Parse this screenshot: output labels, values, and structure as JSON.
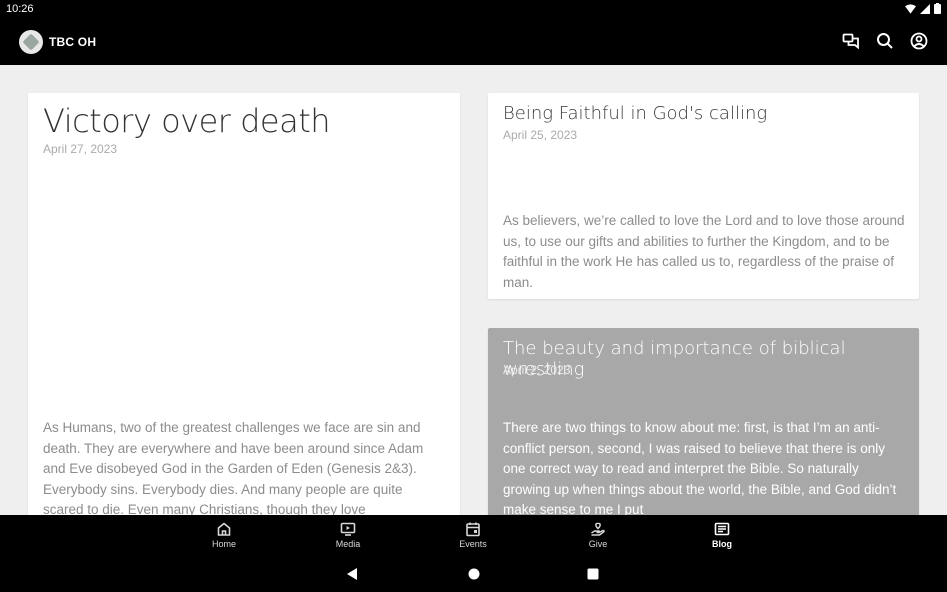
{
  "status": {
    "time": "10:26"
  },
  "app": {
    "title": "TBC OH"
  },
  "actions": [
    "chat-icon",
    "search-icon",
    "account-icon"
  ],
  "posts": [
    {
      "title": "Victory over death",
      "date": "April 27, 2023",
      "excerpt": "As Humans, two of the greatest challenges we face are sin and death. They are everywhere and have been around since Adam and Eve disobeyed God in the Garden of Eden (Genesis 2&3). Everybody sins. Everybody dies. And many people are quite scared to die. Even many Christians, though they love"
    },
    {
      "title": "Being Faithful in God's calling",
      "date": "April 25, 2023",
      "excerpt": "As believers, we’re called to love the Lord and to love those around us, to use our gifts and abilities to further the Kingdom, and to be faithful in the work He has called us to, regardless of the praise of man."
    },
    {
      "title": "The beauty and importance of biblical wrestling",
      "date": "April 2, 2023",
      "excerpt": "There are two things to know about me: first, is that I’m an anti-conflict person, second, I was raised to believe that there is only one correct way to read and interpret the Bible. So naturally growing up when things about the world, the Bible, and God didn’t make sense to me I put"
    }
  ],
  "nav": [
    {
      "label": "Home",
      "icon": "home-icon"
    },
    {
      "label": "Media",
      "icon": "media-icon"
    },
    {
      "label": "Events",
      "icon": "calendar-icon"
    },
    {
      "label": "Give",
      "icon": "give-icon"
    },
    {
      "label": "Blog",
      "icon": "blog-icon",
      "active": true
    }
  ]
}
